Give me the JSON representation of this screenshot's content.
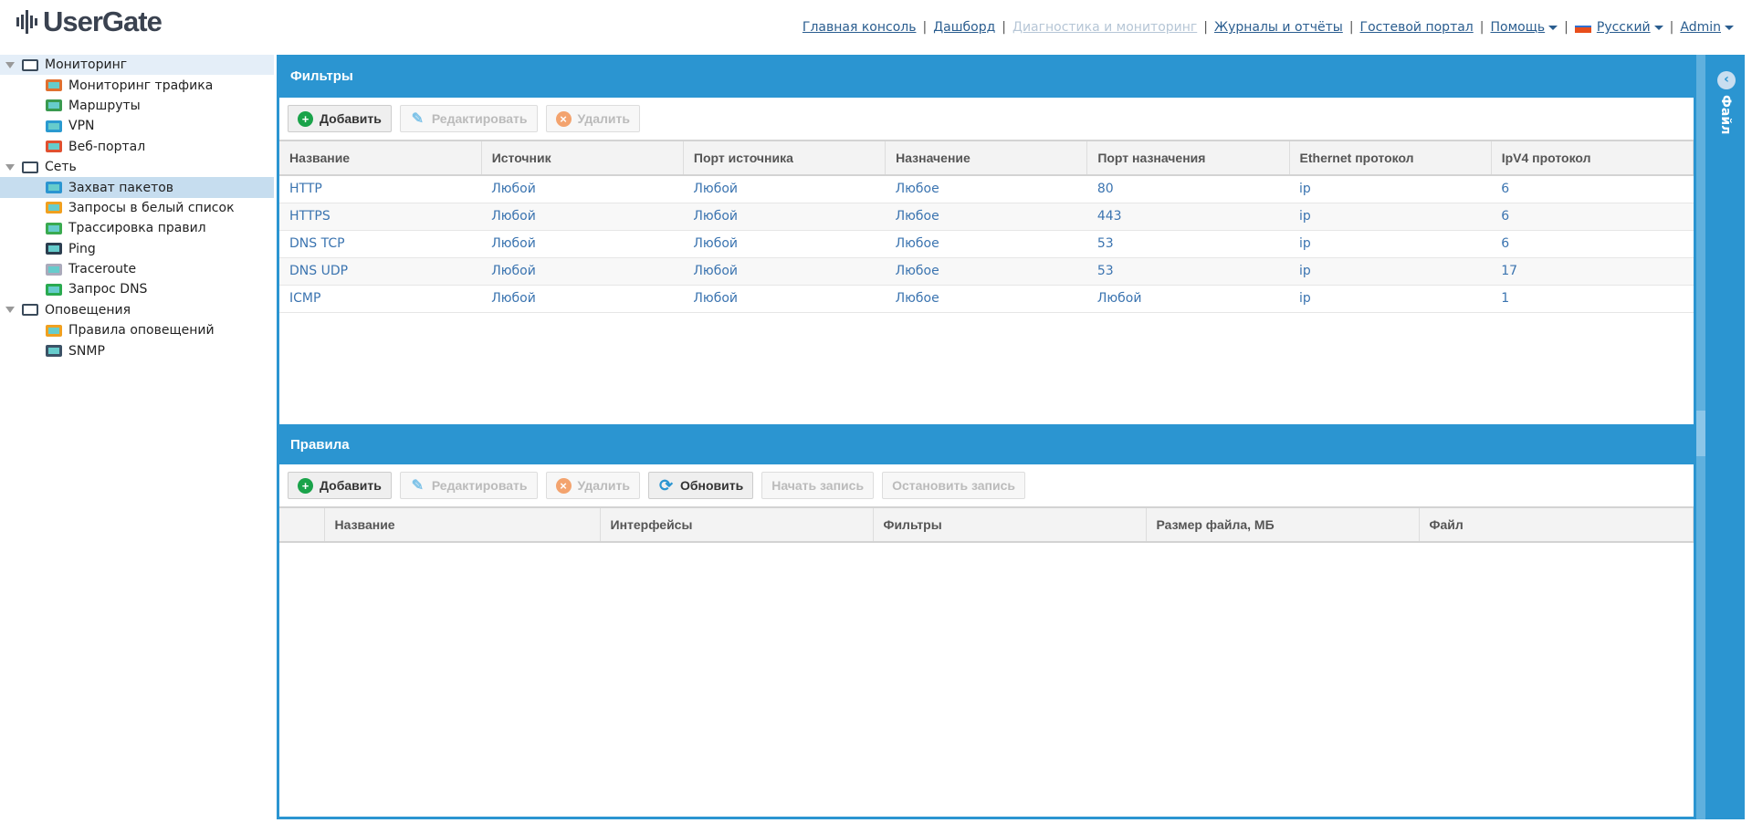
{
  "app": {
    "logo": "UserGate"
  },
  "topnav": {
    "items": [
      {
        "label": "Главная консоль",
        "disabled": false
      },
      {
        "label": "Дашборд",
        "disabled": false
      },
      {
        "label": "Диагностика и мониторинг",
        "disabled": true
      },
      {
        "label": "Журналы и отчёты",
        "disabled": false
      },
      {
        "label": "Гостевой портал",
        "disabled": false
      }
    ],
    "help": "Помощь",
    "language": "Русский",
    "user": "Admin"
  },
  "sidebar": {
    "groups": [
      {
        "label": "Мониторинг",
        "items": [
          "Мониторинг трафика",
          "Маршруты",
          "VPN",
          "Веб-портал"
        ]
      },
      {
        "label": "Сеть",
        "items": [
          "Захват пакетов",
          "Запросы в белый список",
          "Трассировка правил",
          "Ping",
          "Traceroute",
          "Запрос DNS"
        ]
      },
      {
        "label": "Оповещения",
        "items": [
          "Правила оповещений",
          "SNMP"
        ]
      }
    ],
    "selected": "Захват пакетов"
  },
  "filters": {
    "title": "Фильтры",
    "buttons": {
      "add": "Добавить",
      "edit": "Редактировать",
      "delete": "Удалить"
    },
    "columns": [
      "Название",
      "Источник",
      "Порт источника",
      "Назначение",
      "Порт назначения",
      "Ethernet протокол",
      "IpV4 протокол"
    ],
    "rows": [
      [
        "HTTP",
        "Любой",
        "Любой",
        "Любое",
        "80",
        "ip",
        "6"
      ],
      [
        "HTTPS",
        "Любой",
        "Любой",
        "Любое",
        "443",
        "ip",
        "6"
      ],
      [
        "DNS TCP",
        "Любой",
        "Любой",
        "Любое",
        "53",
        "ip",
        "6"
      ],
      [
        "DNS UDP",
        "Любой",
        "Любой",
        "Любое",
        "53",
        "ip",
        "17"
      ],
      [
        "ICMP",
        "Любой",
        "Любой",
        "Любое",
        "Любой",
        "ip",
        "1"
      ]
    ]
  },
  "rules": {
    "title": "Правила",
    "buttons": {
      "add": "Добавить",
      "edit": "Редактировать",
      "delete": "Удалить",
      "refresh": "Обновить",
      "start": "Начать запись",
      "stop": "Остановить запись"
    },
    "columns": [
      "Название",
      "Интерфейсы",
      "Фильтры",
      "Размер файла, МБ",
      "Файл"
    ],
    "rows": []
  },
  "right_panel": {
    "label": "Файл"
  },
  "colors": {
    "accent": "#2b95d1",
    "link": "#3b74b0"
  }
}
